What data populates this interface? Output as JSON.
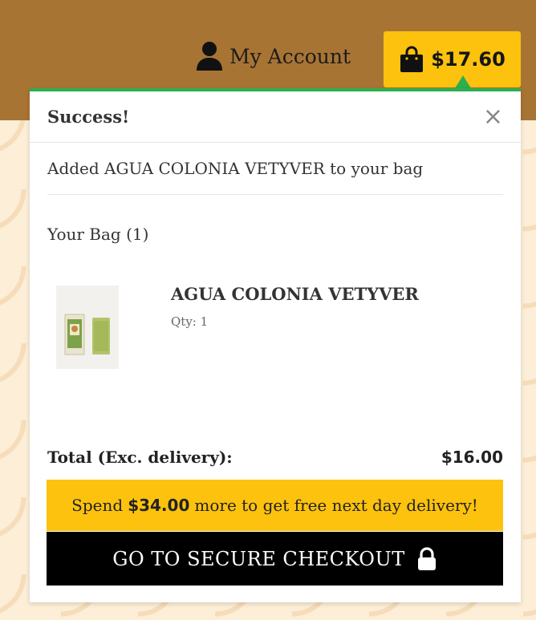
{
  "header": {
    "account_label": "My Account",
    "bag_total": "$17.60",
    "colors": {
      "header_bg": "#a87434",
      "accent": "#fcc20d",
      "success": "#2eae4e"
    },
    "icons": {
      "account": "user-icon",
      "bag": "shopping-bag-icon"
    }
  },
  "popup": {
    "title": "Success!",
    "close_glyph": "×",
    "message": "Added AGUA COLONIA VETYVER to your bag",
    "bag_count_label": "Your Bag (1)",
    "item": {
      "name": "AGUA COLONIA VETYVER",
      "qty": "Qty: 1"
    },
    "total_label": "Total (Exc. delivery):",
    "total_value": "$16.00",
    "promo": {
      "prefix": "Spend",
      "amount": "$34.00",
      "suffix": "more to get free next day delivery!"
    },
    "checkout_label": "GO TO SECURE CHECKOUT",
    "checkout_icon": "lock-icon"
  }
}
